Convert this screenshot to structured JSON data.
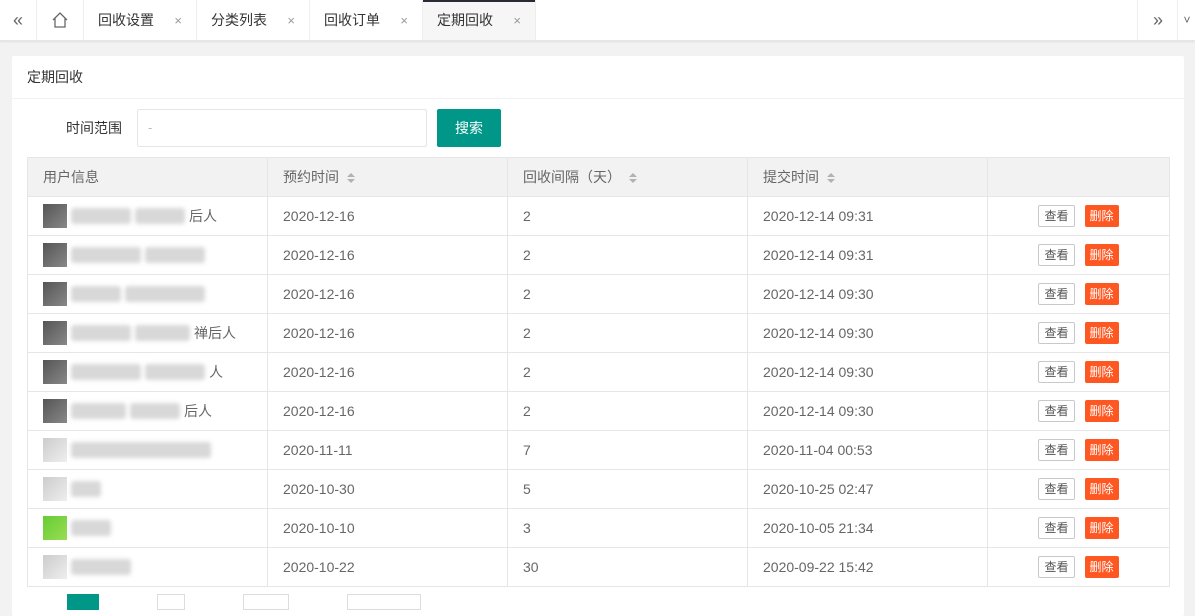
{
  "tabbar": {
    "prev_icon": "double-chevron-left-icon",
    "home_icon": "home-icon",
    "next_icon": "double-chevron-right-icon",
    "dropdown_icon": "chevron-down-icon",
    "tabs": [
      {
        "label": "回收设置",
        "close": "×"
      },
      {
        "label": "分类列表",
        "close": "×"
      },
      {
        "label": "回收订单",
        "close": "×"
      },
      {
        "label": "定期回收",
        "close": "×",
        "active": true
      }
    ]
  },
  "card": {
    "title": "定期回收",
    "search": {
      "label": "时间范围",
      "input_value": "-",
      "button_label": "搜索"
    }
  },
  "table": {
    "headers": [
      "用户信息",
      "预约时间",
      "回收间隔（天）",
      "提交时间",
      ""
    ],
    "rows": [
      {
        "user": "后人",
        "booking": "2020-12-16",
        "interval": "2",
        "submitted": "2020-12-14 09:31"
      },
      {
        "user": "",
        "booking": "2020-12-16",
        "interval": "2",
        "submitted": "2020-12-14 09:31"
      },
      {
        "user": "",
        "booking": "2020-12-16",
        "interval": "2",
        "submitted": "2020-12-14 09:30"
      },
      {
        "user": "禅后人",
        "booking": "2020-12-16",
        "interval": "2",
        "submitted": "2020-12-14 09:30"
      },
      {
        "user": "人",
        "booking": "2020-12-16",
        "interval": "2",
        "submitted": "2020-12-14 09:30"
      },
      {
        "user": "后人",
        "booking": "2020-12-16",
        "interval": "2",
        "submitted": "2020-12-14 09:30"
      },
      {
        "user": "",
        "booking": "2020-11-11",
        "interval": "7",
        "submitted": "2020-11-04 00:53"
      },
      {
        "user": "",
        "booking": "2020-10-30",
        "interval": "5",
        "submitted": "2020-10-25 02:47"
      },
      {
        "user": "",
        "booking": "2020-10-10",
        "interval": "3",
        "submitted": "2020-10-05 21:34"
      },
      {
        "user": "",
        "booking": "2020-10-22",
        "interval": "30",
        "submitted": "2020-09-22 15:42"
      }
    ],
    "view_label": "查看",
    "delete_label": "删除"
  },
  "colors": {
    "primary": "#009688",
    "danger": "#ff5722"
  }
}
